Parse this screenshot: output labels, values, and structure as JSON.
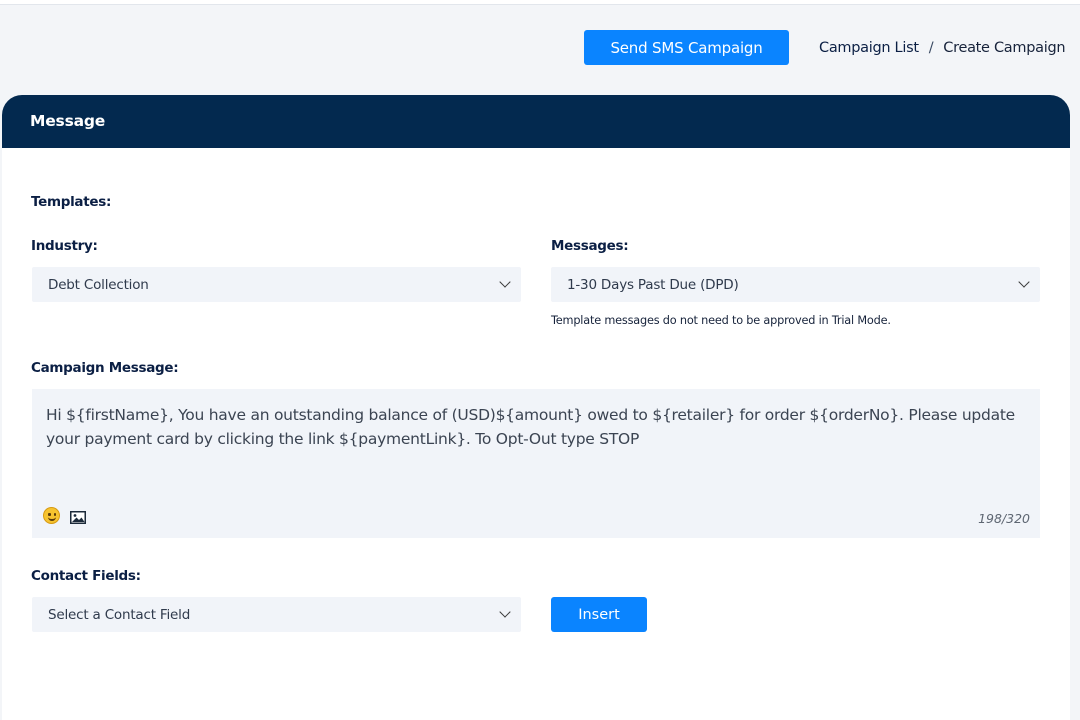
{
  "header": {
    "send_button_label": "Send SMS Campaign",
    "breadcrumb": {
      "parent": "Campaign List",
      "separator": "/",
      "current": "Create Campaign"
    }
  },
  "card": {
    "title": "Message",
    "templates_label": "Templates:",
    "industry": {
      "label": "Industry:",
      "selected": "Debt Collection"
    },
    "messages": {
      "label": "Messages:",
      "selected": "1-30 Days Past Due (DPD)",
      "hint": "Template messages do not need to be approved in Trial Mode."
    },
    "campaign_message": {
      "label": "Campaign Message:",
      "text": "Hi ${firstName}, You have an outstanding balance of (USD)${amount} owed to ${retailer} for order ${orderNo}. Please update your payment card by clicking the link ${paymentLink}. To Opt-Out type STOP",
      "counter": "198/320",
      "icons": [
        "emoji-icon",
        "image-icon"
      ]
    },
    "contact_fields": {
      "label": "Contact Fields:",
      "selected": "Select a Contact Field",
      "insert_label": "Insert"
    }
  },
  "colors": {
    "header_bg": "#03294f",
    "primary_button": "#0a84ff",
    "field_bg": "#f1f4f9",
    "label_text": "#0b1f44"
  }
}
